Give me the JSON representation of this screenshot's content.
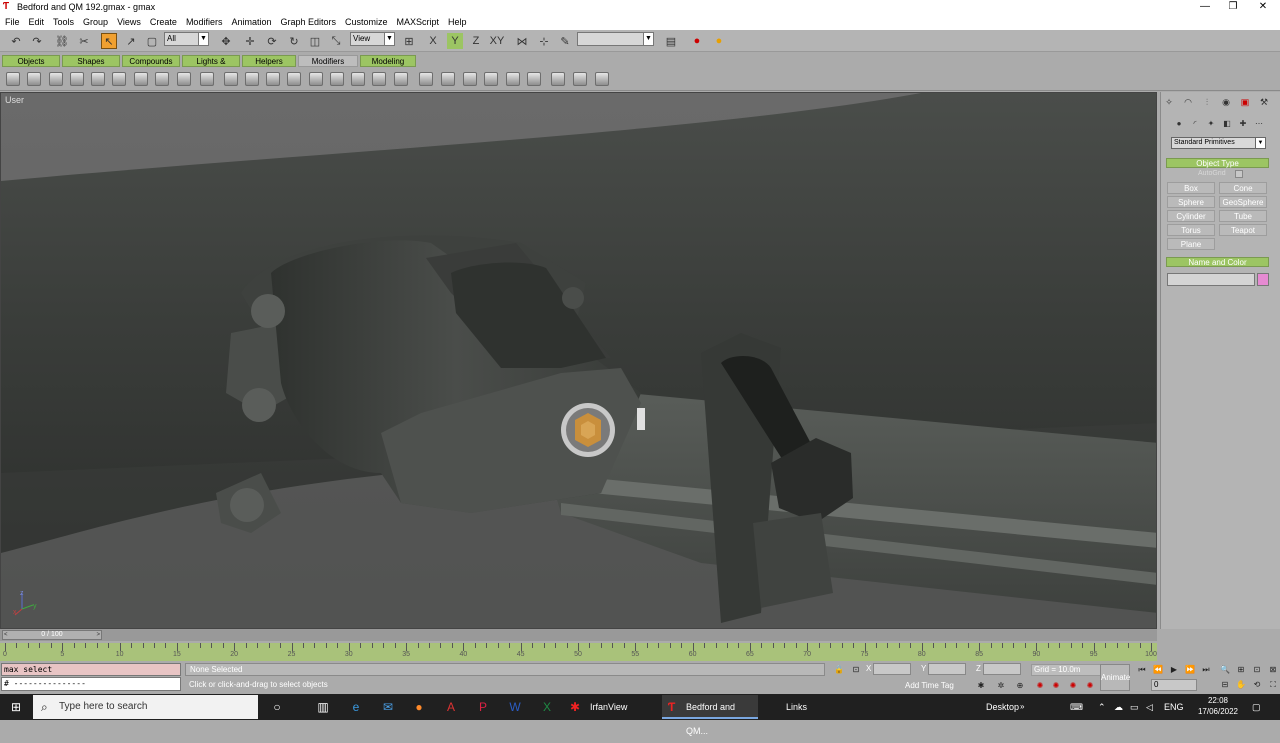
{
  "window": {
    "title": "Bedford and QM 192.gmax - gmax"
  },
  "menu": [
    "File",
    "Edit",
    "Tools",
    "Group",
    "Views",
    "Create",
    "Modifiers",
    "Animation",
    "Graph Editors",
    "Customize",
    "MAXScript",
    "Help"
  ],
  "toolbar": {
    "selection_filter": "All",
    "ref_coord": "View",
    "named_selection": ""
  },
  "tabs": [
    "Objects",
    "Shapes",
    "Compounds",
    "Lights & Cameras",
    "Helpers",
    "Modifiers",
    "Modeling"
  ],
  "viewport": {
    "label": "User"
  },
  "command_panel": {
    "category": "Standard Primitives",
    "rollouts": {
      "object_type": "Object Type",
      "name_color": "Name and Color"
    },
    "autogrid": "AutoGrid",
    "buttons": [
      "Box",
      "Cone",
      "Sphere",
      "GeoSphere",
      "Cylinder",
      "Tube",
      "Torus",
      "Teapot",
      "Plane"
    ],
    "color": "#e68ad2"
  },
  "time": {
    "position": "0 / 100",
    "current_frame": "0"
  },
  "track_ticks": [
    "0",
    "5",
    "10",
    "15",
    "20",
    "25",
    "30",
    "35",
    "40",
    "45",
    "50",
    "55",
    "60",
    "65",
    "70",
    "75",
    "80",
    "85",
    "90",
    "95",
    "100"
  ],
  "status": {
    "maxscript_top": "max select",
    "maxscript_bottom": "# ---------------",
    "selection": "None Selected",
    "prompt": "Click or click-and-drag to select objects",
    "x_label": "X",
    "y_label": "Y",
    "z_label": "Z",
    "grid": "Grid = 10.0m",
    "add_time_tag": "Add Time Tag",
    "animate": "Animate"
  },
  "taskbar": {
    "search_placeholder": "Type here to search",
    "windows": [
      "IrfanView",
      "Bedford and QM...",
      "Links"
    ],
    "desktop": "Desktop",
    "lang": "ENG",
    "time": "22:08",
    "date": "17/06/2022"
  }
}
